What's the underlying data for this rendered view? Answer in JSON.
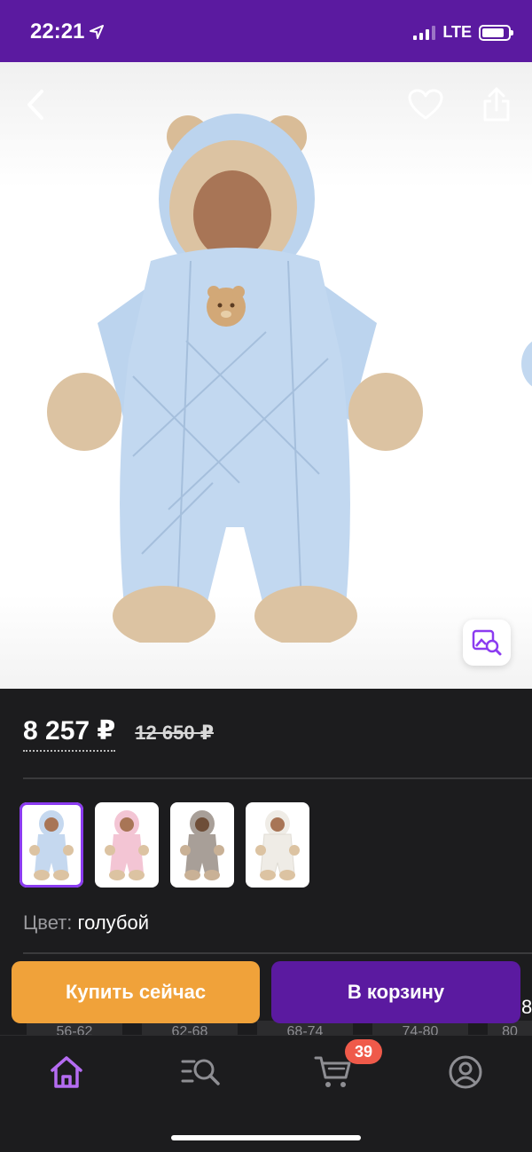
{
  "status": {
    "time": "22:21",
    "network": "LTE"
  },
  "product": {
    "price": "8 257 ₽",
    "old_price": "12 650 ₽",
    "color_label": "Цвет:",
    "color_value": "голубой",
    "image_icon": "baby-snowsuit-blue",
    "swatches": [
      {
        "icon": "snowsuit-blue",
        "color": "#c5d8ef"
      },
      {
        "icon": "snowsuit-pink",
        "color": "#f3c5d4"
      },
      {
        "icon": "snowsuit-gray",
        "color": "#a89f98"
      },
      {
        "icon": "snowsuit-white",
        "color": "#f5f3ef"
      }
    ]
  },
  "sizes": [
    "56-62",
    "62-68",
    "68-74",
    "74-80",
    "80"
  ],
  "edge_char": "8",
  "actions": {
    "buy_now": "Купить сейчас",
    "add_to_cart": "В корзину"
  },
  "tabbar": {
    "items": [
      {
        "icon": "home-icon",
        "active": true
      },
      {
        "icon": "catalog-search-icon",
        "active": false
      },
      {
        "icon": "cart-icon",
        "active": false
      },
      {
        "icon": "profile-icon",
        "active": false
      }
    ],
    "cart_badge": "39"
  },
  "colors": {
    "accent": "#5b1aa0",
    "buy": "#f0a23a",
    "badge": "#ef5a4a",
    "active_tab": "#b56cf2"
  }
}
